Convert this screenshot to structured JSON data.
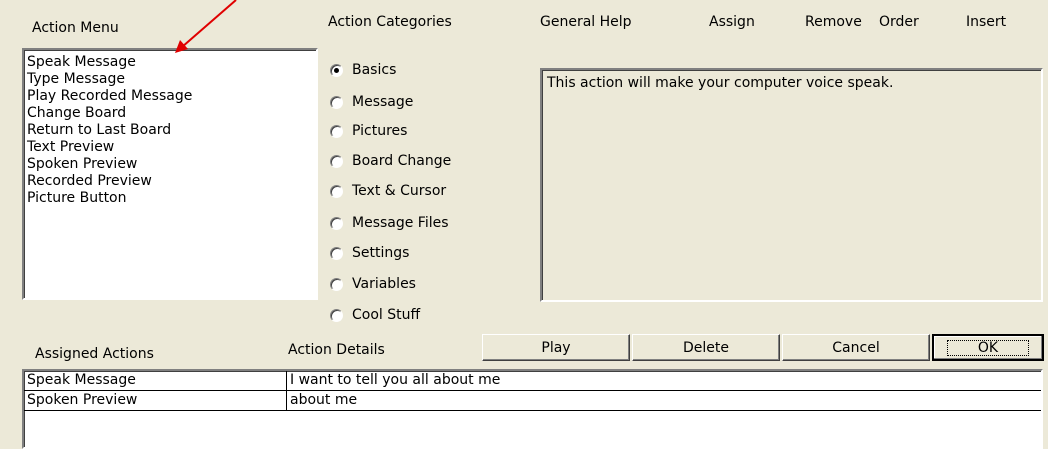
{
  "headers": {
    "action_menu": "Action Menu",
    "action_categories": "Action Categories",
    "general_help": "General Help",
    "assign": "Assign",
    "remove": "Remove",
    "order": "Order",
    "insert": "Insert",
    "assigned_actions": "Assigned Actions",
    "action_details": "Action Details"
  },
  "action_menu": {
    "items": [
      "Speak Message",
      "Type Message",
      "Play Recorded Message",
      "Change Board",
      "Return to Last Board",
      "Text Preview",
      "Spoken Preview",
      "Recorded Preview",
      "Picture Button"
    ]
  },
  "categories": {
    "selected": "Basics",
    "options": [
      "Basics",
      "Message",
      "Pictures",
      "Board Change",
      "Text & Cursor",
      "Message Files",
      "Settings",
      "Variables",
      "Cool Stuff"
    ]
  },
  "help": {
    "text": "This action will make your computer voice speak."
  },
  "buttons": {
    "play": "Play",
    "delete": "Delete",
    "cancel": "Cancel",
    "ok": "OK"
  },
  "assigned": {
    "rows": [
      {
        "action": "Speak Message",
        "details": "I want to tell you all about me"
      },
      {
        "action": "Spoken Preview",
        "details": "about me"
      }
    ]
  },
  "colors": {
    "window_bg": "#ECE9D8",
    "annotation_arrow": "#E00000"
  }
}
